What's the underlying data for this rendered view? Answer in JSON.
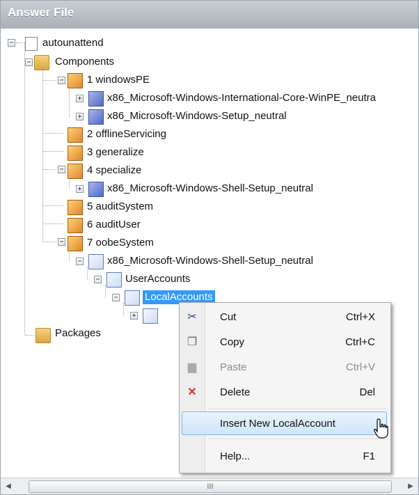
{
  "panel": {
    "title": "Answer File"
  },
  "tree": {
    "root": "autounattend",
    "components": "Components",
    "pass1": "1 windowsPE",
    "pass1_c1": "x86_Microsoft-Windows-International-Core-WinPE_neutra",
    "pass1_c2": "x86_Microsoft-Windows-Setup_neutral",
    "pass2": "2 offlineServicing",
    "pass3": "3 generalize",
    "pass4": "4 specialize",
    "pass4_c1": "x86_Microsoft-Windows-Shell-Setup_neutral",
    "pass5": "5 auditSystem",
    "pass6": "6 auditUser",
    "pass7": "7 oobeSystem",
    "pass7_c1": "x86_Microsoft-Windows-Shell-Setup_neutral",
    "user_accounts": "UserAccounts",
    "local_accounts": "LocalAccounts",
    "packages": "Packages"
  },
  "context_menu": {
    "cut": {
      "label": "Cut",
      "shortcut": "Ctrl+X"
    },
    "copy": {
      "label": "Copy",
      "shortcut": "Ctrl+C"
    },
    "paste": {
      "label": "Paste",
      "shortcut": "Ctrl+V"
    },
    "delete": {
      "label": "Delete",
      "shortcut": "Del"
    },
    "insert": {
      "label": "Insert New LocalAccount"
    },
    "help": {
      "label": "Help...",
      "shortcut": "F1"
    }
  },
  "scrollbar": {
    "thumb_grip": "III"
  },
  "colors": {
    "selection": "#3399ff",
    "title_bar": "#b6bcc2",
    "menu_hover": "#cfe5fb"
  }
}
